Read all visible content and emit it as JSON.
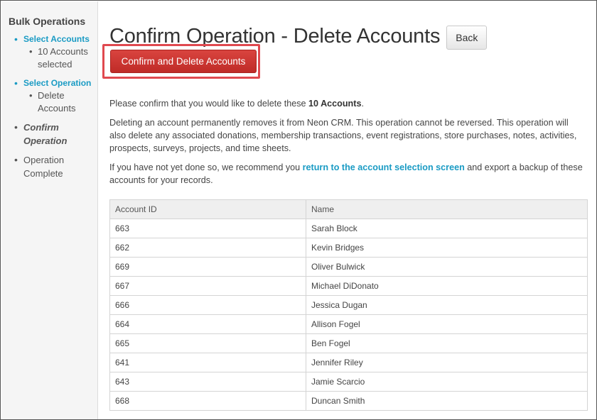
{
  "sidebar": {
    "title": "Bulk Operations",
    "steps": [
      {
        "label": "Select Accounts",
        "detail": "10 Accounts selected"
      },
      {
        "label": "Select Operation",
        "detail": "Delete Accounts"
      },
      {
        "label": "Confirm Operation"
      },
      {
        "label": "Operation Complete"
      }
    ]
  },
  "header": {
    "title": "Confirm Operation - Delete Accounts",
    "back_label": "Back",
    "confirm_label": "Confirm and Delete Accounts"
  },
  "content": {
    "intro_prefix": "Please confirm that you would like to delete these ",
    "intro_count": "10 Accounts",
    "intro_suffix": ".",
    "warning": "Deleting an account permanently removes it from Neon CRM. This operation cannot be reversed. This operation will also delete any associated donations, membership transactions, event registrations, store purchases, notes, activities, prospects, surveys, projects, and time sheets.",
    "backup_prefix": "If you have not yet done so, we recommend you ",
    "backup_link": "return to the account selection screen",
    "backup_suffix": " and export a backup of these accounts for your records."
  },
  "table": {
    "columns": [
      "Account ID",
      "Name"
    ],
    "rows": [
      [
        "663",
        "Sarah Block"
      ],
      [
        "662",
        "Kevin Bridges"
      ],
      [
        "669",
        "Oliver Bulwick"
      ],
      [
        "667",
        "Michael DiDonato"
      ],
      [
        "666",
        "Jessica Dugan"
      ],
      [
        "664",
        "Allison Fogel"
      ],
      [
        "665",
        "Ben Fogel"
      ],
      [
        "641",
        "Jennifer Riley"
      ],
      [
        "643",
        "Jamie Scarcio"
      ],
      [
        "668",
        "Duncan Smith"
      ]
    ]
  },
  "colors": {
    "link": "#1a9bc4",
    "danger": "#c9302c",
    "highlight": "#e0494f"
  }
}
